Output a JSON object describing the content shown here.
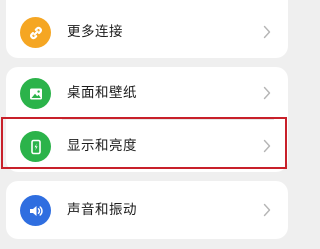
{
  "settings": {
    "items": [
      {
        "label": "更多连接",
        "icon": "link-icon",
        "color": "#f5a623"
      },
      {
        "label": "桌面和壁纸",
        "icon": "wallpaper-icon",
        "color": "#2bb34a"
      },
      {
        "label": "显示和亮度",
        "icon": "phone-brightness-icon",
        "color": "#2bb34a",
        "highlighted": true
      },
      {
        "label": "声音和振动",
        "icon": "speaker-icon",
        "color": "#2f6ee0"
      }
    ]
  },
  "colors": {
    "background": "#efefef",
    "card": "#ffffff",
    "highlight_border": "#c8202a"
  }
}
